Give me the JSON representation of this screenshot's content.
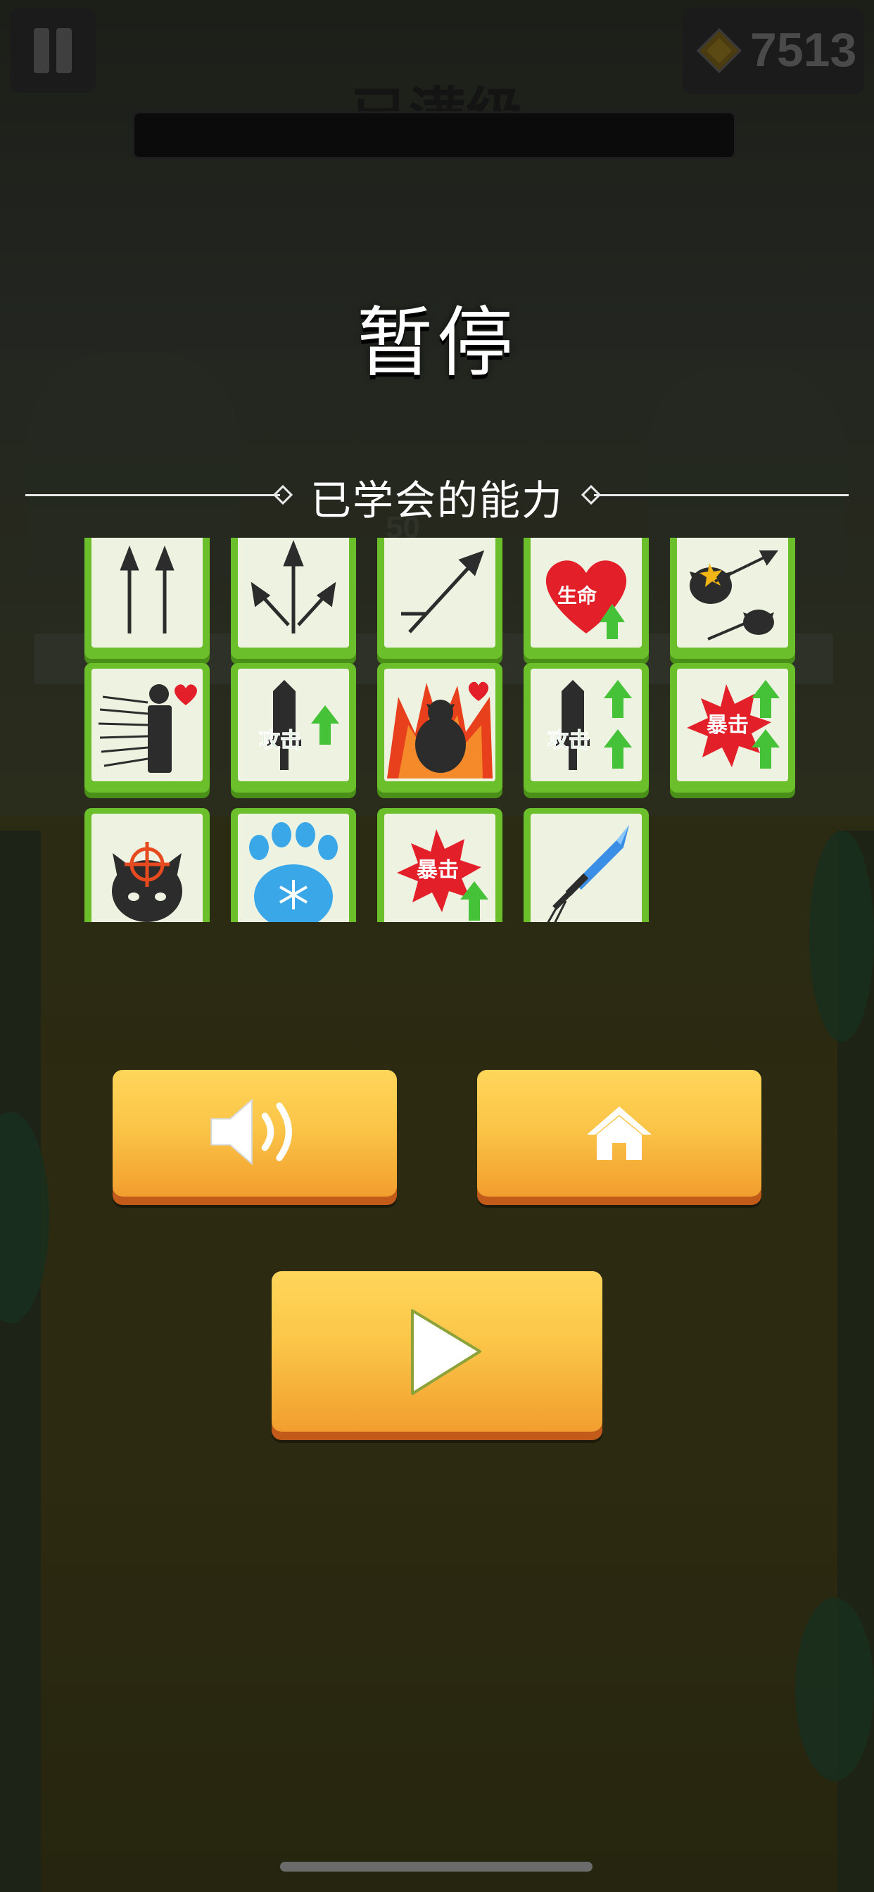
{
  "hud": {
    "gem_count": "7513",
    "level_status": "已满级"
  },
  "pause_menu": {
    "title": "暂停",
    "learned_abilities_heading": "已学会的能力",
    "background_number": "50"
  },
  "abilities": [
    {
      "icon": "double-arrow-icon"
    },
    {
      "icon": "triple-spread-arrow-icon"
    },
    {
      "icon": "diagonal-arrow-icon"
    },
    {
      "icon": "health-up-icon",
      "label": "生命"
    },
    {
      "icon": "ricochet-arrow-icon"
    },
    {
      "icon": "speed-dash-heart-icon"
    },
    {
      "icon": "attack-up-icon",
      "label": "攻击"
    },
    {
      "icon": "rage-heart-icon"
    },
    {
      "icon": "attack-up-double-icon",
      "label": "攻击"
    },
    {
      "icon": "crit-up-double-icon",
      "label": "暴击"
    },
    {
      "icon": "headshot-target-icon"
    },
    {
      "icon": "frost-paw-icon"
    },
    {
      "icon": "crit-up-icon",
      "label": "暴击"
    },
    {
      "icon": "blue-sword-icon"
    }
  ],
  "buttons": {
    "sound": {
      "icon": "speaker-icon"
    },
    "home": {
      "icon": "home-icon"
    },
    "resume": {
      "icon": "play-icon"
    }
  },
  "colors": {
    "tile_green": "#6abf2a",
    "button_orange": "#f7b13c",
    "arrow_dark": "#2c2c2c",
    "up_green": "#45c238",
    "heart_red": "#e3202a"
  }
}
